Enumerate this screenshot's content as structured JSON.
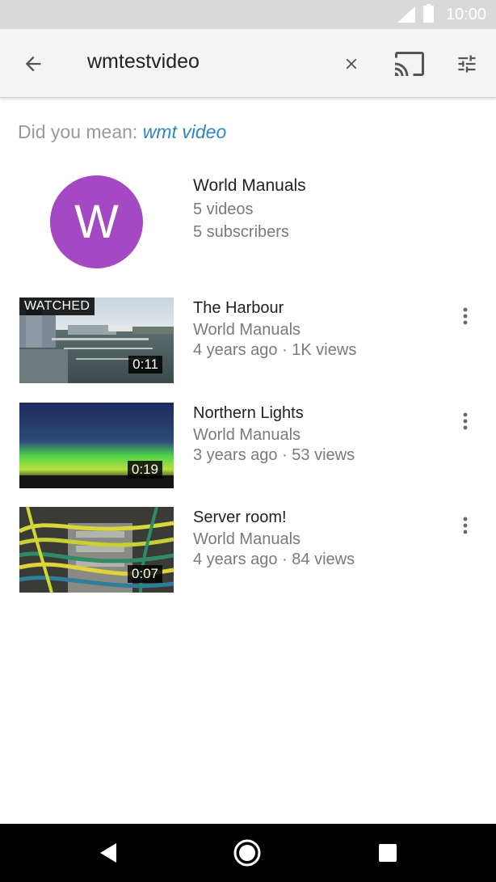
{
  "status_bar": {
    "time": "10:00"
  },
  "toolbar": {
    "query": "wmtestvideo",
    "icons": [
      "back-arrow-icon",
      "close-icon",
      "cast-icon",
      "filter-icon"
    ]
  },
  "suggestion": {
    "prefix": "Did you mean: ",
    "link": "wmt video"
  },
  "channel": {
    "avatar_letter": "W",
    "avatar_color": "#a448c4",
    "name": "World Manuals",
    "videos": "5 videos",
    "subscribers": "5 subscribers"
  },
  "videos": [
    {
      "title": "The Harbour",
      "channel": "World Manuals",
      "meta": "4 years ago · 1K views",
      "duration": "0:11",
      "badge": "WATCHED"
    },
    {
      "title": "Northern Lights",
      "channel": "World Manuals",
      "meta": "3 years ago · 53 views",
      "duration": "0:19"
    },
    {
      "title": "Server room!",
      "channel": "World Manuals",
      "meta": "4 years ago · 84 views",
      "duration": "0:07"
    }
  ],
  "colors": {
    "link": "#2b86c5",
    "secondary_text": "#7a7a7a"
  },
  "nav_bar": {
    "icons": [
      "nav-back-icon",
      "nav-home-icon",
      "nav-recents-icon"
    ]
  }
}
